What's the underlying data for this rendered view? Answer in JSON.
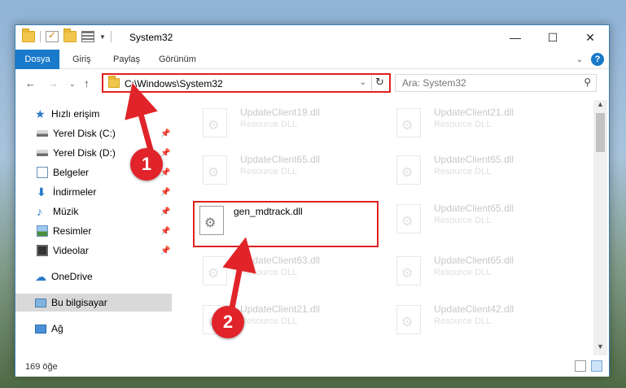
{
  "window": {
    "title": "System32",
    "controls": {
      "minimize": "—",
      "maximize": "☐",
      "close": "✕"
    }
  },
  "ribbon": {
    "file_tab": "Dosya",
    "tabs": [
      "Giriş",
      "Paylaş",
      "Görünüm"
    ]
  },
  "navigation": {
    "address": "C:\\Windows\\System32",
    "search_placeholder": "Ara: System32"
  },
  "sidebar": {
    "quick_access": "Hızlı erişim",
    "items": [
      {
        "label": "Yerel Disk (C:)",
        "icon": "drive-icon",
        "pinned": true
      },
      {
        "label": "Yerel Disk (D:)",
        "icon": "drive-icon",
        "pinned": true
      },
      {
        "label": "Belgeler",
        "icon": "documents-icon",
        "pinned": true
      },
      {
        "label": "İndirmeler",
        "icon": "downloads-icon",
        "pinned": true
      },
      {
        "label": "Müzik",
        "icon": "music-icon",
        "pinned": true
      },
      {
        "label": "Resimler",
        "icon": "pictures-icon",
        "pinned": true
      },
      {
        "label": "Videolar",
        "icon": "videos-icon",
        "pinned": true
      }
    ],
    "onedrive": "OneDrive",
    "this_pc": "Bu bilgisayar",
    "network": "Ağ"
  },
  "files": {
    "left": [
      {
        "name": "UpdateClient19.dll",
        "type": "Resource DLL"
      },
      {
        "name": "UpdateClient65.dll",
        "type": "Resource DLL"
      },
      {
        "name": "gen_mdtrack.dll",
        "type": ""
      },
      {
        "name": "UpdateClient63.dll",
        "type": "Resource DLL"
      },
      {
        "name": "UpdateClient21.dll",
        "type": "Resource DLL"
      }
    ],
    "right": [
      {
        "name": "UpdateClient21.dll",
        "type": "Resource DLL"
      },
      {
        "name": "UpdateClient65.dll",
        "type": "Resource DLL"
      },
      {
        "name": "UpdateClient65.dll",
        "type": "Resource DLL"
      },
      {
        "name": "UpdateClient65.dll",
        "type": "Resource DLL"
      },
      {
        "name": "UpdateClient42.dll",
        "type": "Resource DLL"
      }
    ]
  },
  "status": {
    "item_count": "169 öğe"
  },
  "annotations": {
    "step1": "1",
    "step2": "2",
    "color": "#e0242a"
  }
}
